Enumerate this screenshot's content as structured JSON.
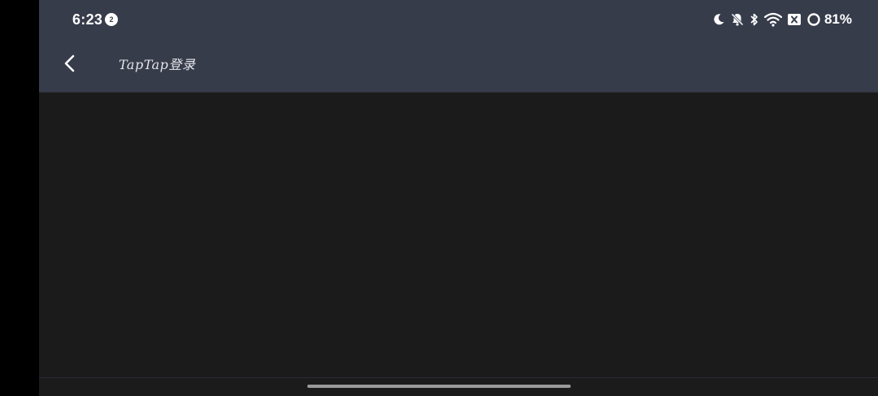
{
  "status_bar": {
    "time": "6:23",
    "notification_badge": "2",
    "icons": [
      "moon-icon",
      "bell-off-icon",
      "bluetooth-icon",
      "wifi-icon",
      "sim-x-icon",
      "battery-ring-icon"
    ],
    "battery": "81%",
    "battery_level": 0.81
  },
  "toolbar": {
    "title": "TapTap登录",
    "back_icon": "chevron-left-icon"
  },
  "colors": {
    "toolbar_bg": "#373c4b",
    "content_bg": "#1b1b1b",
    "side_bg": "#000000"
  }
}
